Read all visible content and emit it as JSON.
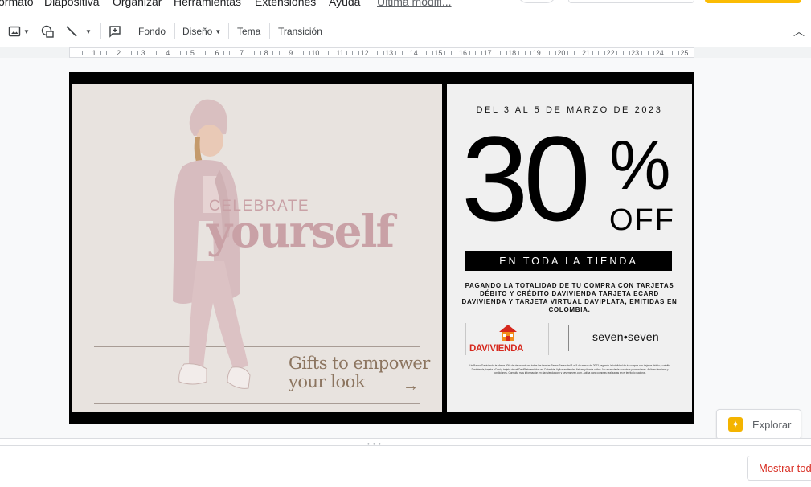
{
  "menu": {
    "items": [
      "ormato",
      "Diapositiva",
      "Organizar",
      "Herramientas",
      "Extensiones",
      "Ayuda"
    ],
    "last_edit": "Última modifi..."
  },
  "toolbar": {
    "fondo": "Fondo",
    "diseno": "Diseño",
    "tema": "Tema",
    "transicion": "Transición"
  },
  "ruler": {
    "ticks": [
      "1",
      "2",
      "3",
      "4",
      "5",
      "6",
      "7",
      "8",
      "9",
      "10",
      "11",
      "12",
      "13",
      "14",
      "15",
      "16",
      "17",
      "18",
      "19",
      "20",
      "21",
      "22",
      "23",
      "24",
      "25"
    ]
  },
  "slide": {
    "left": {
      "celebrate": "CELEBRATE",
      "yourself": "yourself",
      "gifts_line1": "Gifts to empower",
      "gifts_line2": "your look",
      "arrow": "→"
    },
    "right": {
      "date": "DEL 3 AL 5 DE MARZO DE 2023",
      "big_number": "30",
      "percent": "%",
      "off": "OFF",
      "bar_text": "EN TODA LA TIENDA",
      "payment": "PAGANDO LA TOTALIDAD DE TU COMPRA CON TARJETAS DÉBITO Y CRÉDITO DAVIVIENDA TARJETA ECARD DAVIVIENDA Y TARJETA VIRTUAL DAVIPLATA, EMITIDAS EN COLOMBIA.",
      "bank_logo": "DAVIVIENDA",
      "brand_logo": "seven•seven",
      "fine_print": "Un Banco Davivienda te ofrece 30% de descuento en todas las tiendas Seven Seven del 3 al 5 de marzo de 2023 pagando la totalidad de tu compra con tarjetas débito y crédito Davivienda, tarjeta eCard y tarjeta virtual DaviPlata emitidas en Colombia. Aplica en tiendas físicas y tienda online. No acumulable con otras promociones. Aplican términos y condiciones. Consulta más información en davivienda.com y sevenseven.com. Aplica para compras realizadas en el territorio nacional."
    }
  },
  "explorar": {
    "label": "Explorar"
  },
  "notes": {
    "show_button": "Mostrar todo"
  },
  "colors": {
    "accent_pink": "#c9a1a6",
    "brand_red": "#d6281d",
    "explorar_yellow": "#f4b400"
  }
}
